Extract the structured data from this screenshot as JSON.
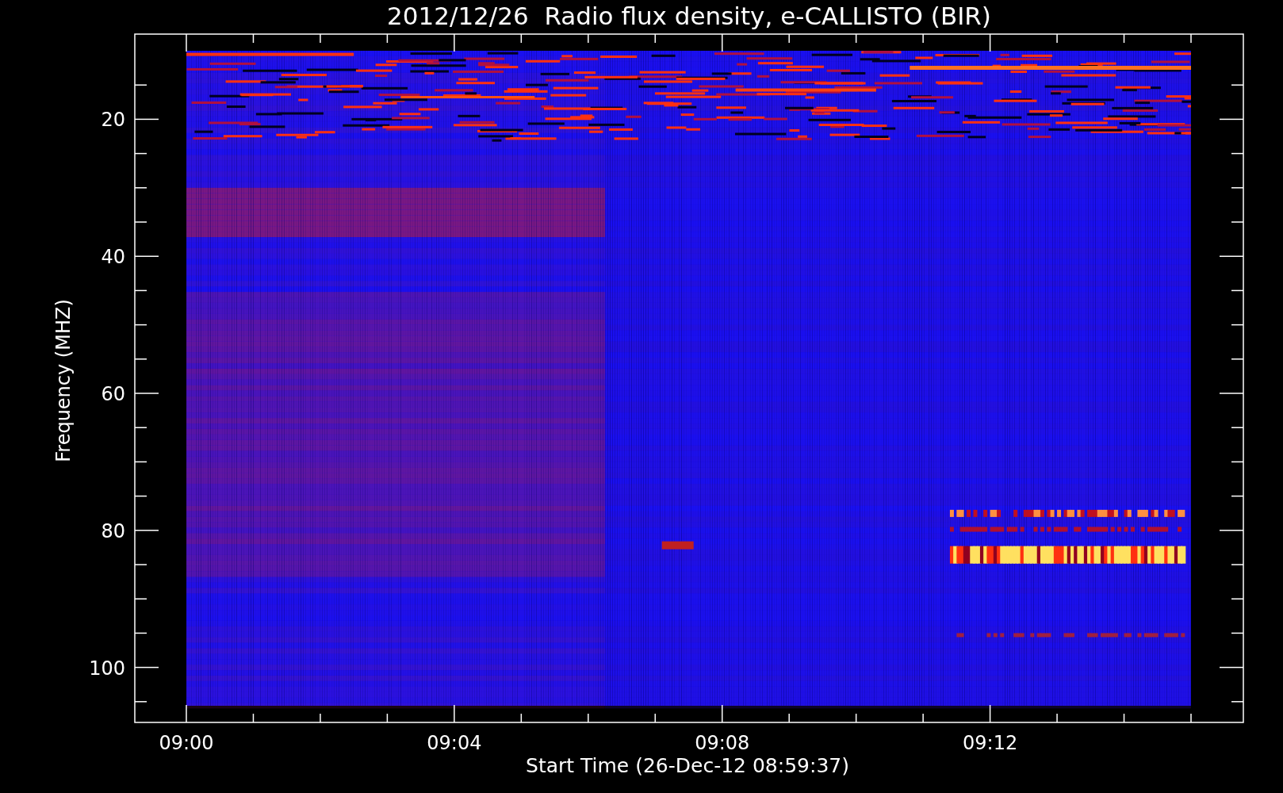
{
  "title": "2012/12/26  Radio flux density, e-CALLISTO (BIR)",
  "y_axis": {
    "label": "Frequency (MHZ)",
    "ticks": [
      "20",
      "40",
      "60",
      "80",
      "100"
    ]
  },
  "x_axis": {
    "label": "Start Time (26-Dec-12 08:59:37)",
    "ticks": [
      "09:00",
      "09:04",
      "09:08",
      "09:12"
    ]
  }
}
